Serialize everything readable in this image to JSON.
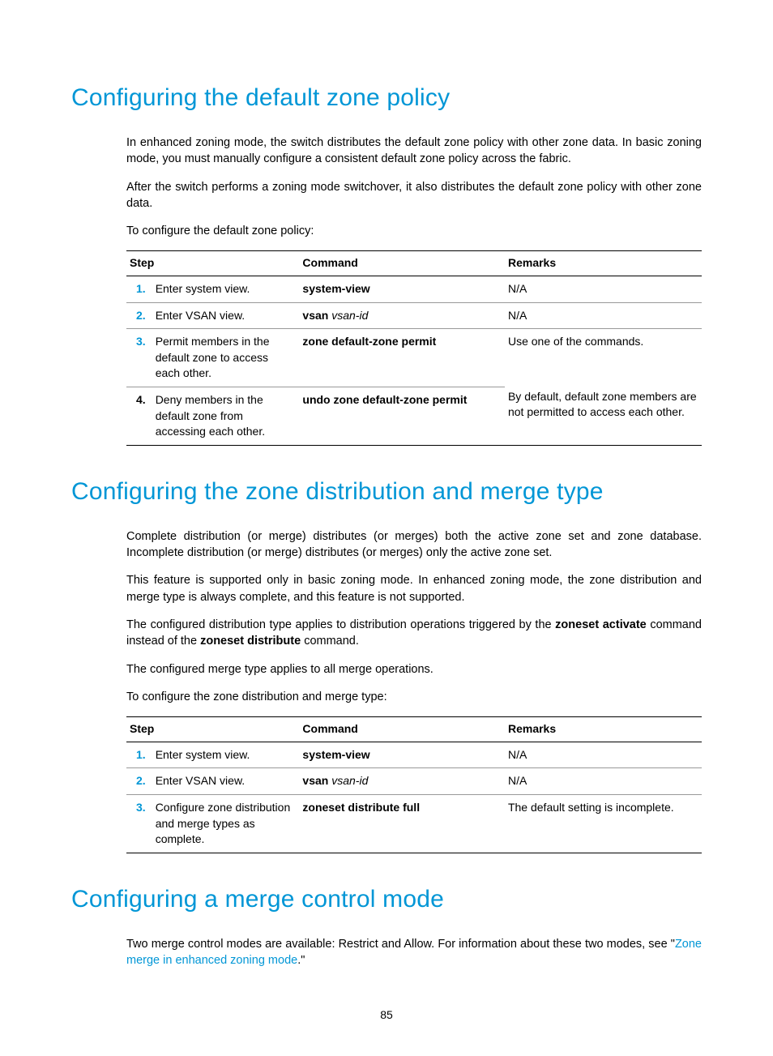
{
  "section1": {
    "heading": "Configuring the default zone policy",
    "p1": "In enhanced zoning mode, the switch distributes the default zone policy with other zone data. In basic zoning mode, you must manually configure a consistent default zone policy across the fabric.",
    "p2": "After the switch performs a zoning mode switchover, it also distributes the default zone policy with other zone data.",
    "p3": "To configure the default zone policy:",
    "table": {
      "headers": {
        "step": "Step",
        "command": "Command",
        "remarks": "Remarks"
      },
      "rows": [
        {
          "num": "1.",
          "desc": "Enter system view.",
          "cmd_bold": "system-view",
          "cmd_ital": "",
          "remarks": "N/A"
        },
        {
          "num": "2.",
          "desc": "Enter VSAN view.",
          "cmd_bold": "vsan",
          "cmd_ital": "vsan-id",
          "remarks": "N/A"
        },
        {
          "num": "3.",
          "desc": "Permit members in the default zone to access each other.",
          "cmd_bold": "zone default-zone permit",
          "cmd_ital": "",
          "remarks_top": "Use one of the commands."
        },
        {
          "num": "4.",
          "desc": "Deny members in the default zone from accessing each other.",
          "cmd_bold": "undo zone default-zone permit",
          "cmd_ital": "",
          "remarks_bottom": "By default, default zone members are not permitted to access each other."
        }
      ]
    }
  },
  "section2": {
    "heading": "Configuring the zone distribution and merge type",
    "p1": "Complete distribution (or merge) distributes (or merges) both the active zone set and zone database. Incomplete distribution (or merge) distributes (or merges) only the active zone set.",
    "p2": "This feature is supported only in basic zoning mode. In enhanced zoning mode, the zone distribution and merge type is always complete, and this feature is not supported.",
    "p3_pre": "The configured distribution type applies to distribution operations triggered by the ",
    "p3_b1": "zoneset activate",
    "p3_mid": " command instead of the ",
    "p3_b2": "zoneset distribute",
    "p3_post": " command.",
    "p4": "The configured merge type applies to all merge operations.",
    "p5": "To configure the zone distribution and merge type:",
    "table": {
      "headers": {
        "step": "Step",
        "command": "Command",
        "remarks": "Remarks"
      },
      "rows": [
        {
          "num": "1.",
          "desc": "Enter system view.",
          "cmd_bold": "system-view",
          "cmd_ital": "",
          "remarks": "N/A"
        },
        {
          "num": "2.",
          "desc": "Enter VSAN view.",
          "cmd_bold": "vsan",
          "cmd_ital": "vsan-id",
          "remarks": "N/A"
        },
        {
          "num": "3.",
          "desc": "Configure zone distribution and merge types as complete.",
          "cmd_bold": "zoneset distribute full",
          "cmd_ital": "",
          "remarks": "The default setting is incomplete."
        }
      ]
    }
  },
  "section3": {
    "heading": "Configuring a merge control mode",
    "p1_pre": "Two merge control modes are available: Restrict and Allow. For information about these two modes, see \"",
    "p1_link": "Zone merge in enhanced zoning mode",
    "p1_post": ".\""
  },
  "pageNumber": "85"
}
